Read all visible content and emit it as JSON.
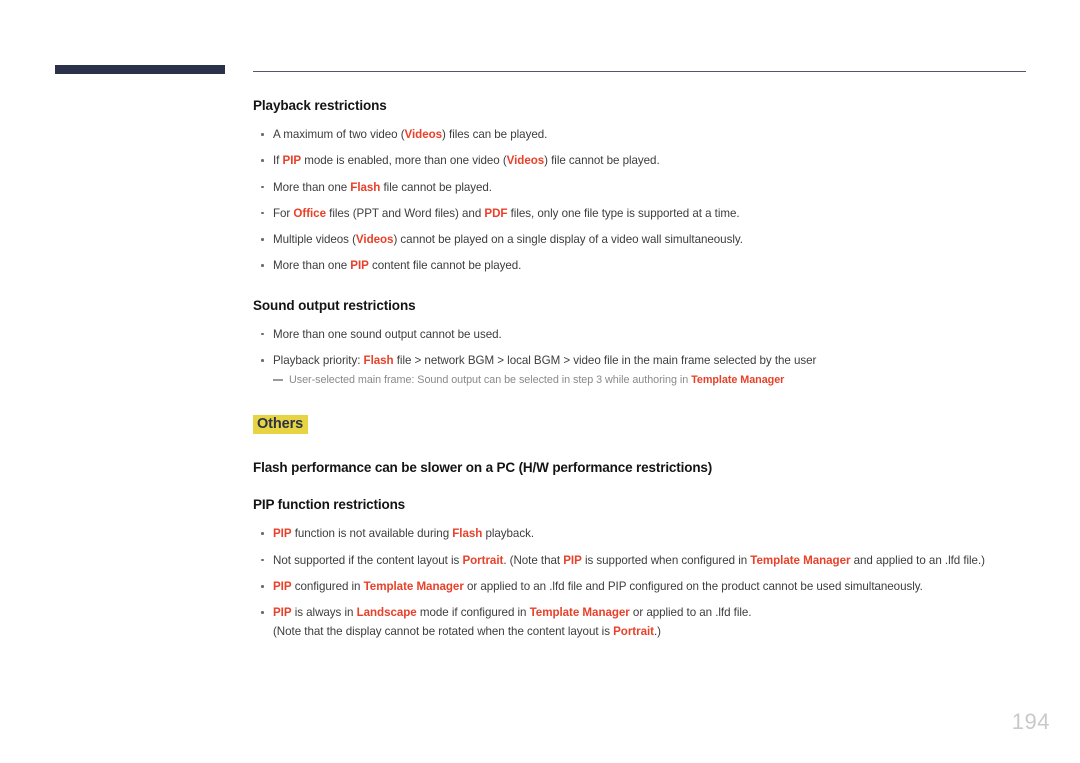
{
  "page": {
    "number": "194",
    "accent_color": "#e8412a",
    "highlight_color": "#e6d442",
    "header_bar_color": "#2b3149"
  },
  "sections": {
    "playback": {
      "heading": "Playback restrictions",
      "bullets": [
        {
          "parts": [
            {
              "t": "A maximum of two video (",
              "a": false
            },
            {
              "t": "Videos",
              "a": true
            },
            {
              "t": ") files can be played.",
              "a": false
            }
          ]
        },
        {
          "parts": [
            {
              "t": "If ",
              "a": false
            },
            {
              "t": "PIP",
              "a": true
            },
            {
              "t": " mode is enabled, more than one video (",
              "a": false
            },
            {
              "t": "Videos",
              "a": true
            },
            {
              "t": ") file cannot be played.",
              "a": false
            }
          ]
        },
        {
          "parts": [
            {
              "t": "More than one ",
              "a": false
            },
            {
              "t": "Flash",
              "a": true
            },
            {
              "t": " file cannot be played.",
              "a": false
            }
          ]
        },
        {
          "parts": [
            {
              "t": "For ",
              "a": false
            },
            {
              "t": "Office",
              "a": true
            },
            {
              "t": " files (PPT and Word files) and ",
              "a": false
            },
            {
              "t": "PDF",
              "a": true
            },
            {
              "t": " files, only one file type is supported at a time.",
              "a": false
            }
          ]
        },
        {
          "parts": [
            {
              "t": "Multiple videos (",
              "a": false
            },
            {
              "t": "Videos",
              "a": true
            },
            {
              "t": ") cannot be played on a single display of a video wall simultaneously.",
              "a": false
            }
          ]
        },
        {
          "parts": [
            {
              "t": "More than one ",
              "a": false
            },
            {
              "t": "PIP",
              "a": true
            },
            {
              "t": " content file cannot be played.",
              "a": false
            }
          ]
        }
      ]
    },
    "sound": {
      "heading": "Sound output restrictions",
      "bullets": [
        {
          "parts": [
            {
              "t": "More than one sound output cannot be used.",
              "a": false
            }
          ]
        },
        {
          "parts": [
            {
              "t": "Playback priority: ",
              "a": false
            },
            {
              "t": "Flash",
              "a": true
            },
            {
              "t": " file > network BGM > local BGM > video file in the main frame selected by the user",
              "a": false
            }
          ]
        }
      ],
      "note": {
        "parts": [
          {
            "t": "User-selected main frame: Sound output can be selected in step 3 while authoring in ",
            "a": false
          },
          {
            "t": "Template Manager",
            "a": true
          }
        ]
      }
    },
    "others": {
      "tag": "Others",
      "heading_flash": "Flash performance can be slower on a PC (H/W performance restrictions)",
      "heading_pip": "PIP function restrictions",
      "bullets": [
        {
          "parts": [
            {
              "t": "PIP",
              "a": true
            },
            {
              "t": " function is not available during ",
              "a": false
            },
            {
              "t": "Flash",
              "a": true
            },
            {
              "t": " playback.",
              "a": false
            }
          ]
        },
        {
          "parts": [
            {
              "t": "Not supported if the content layout is ",
              "a": false
            },
            {
              "t": "Portrait",
              "a": true
            },
            {
              "t": ".  (Note that ",
              "a": false
            },
            {
              "t": "PIP",
              "a": true
            },
            {
              "t": " is supported when configured in ",
              "a": false
            },
            {
              "t": "Template Manager",
              "a": true
            },
            {
              "t": " and applied to an .lfd file.)",
              "a": false
            }
          ]
        },
        {
          "parts": [
            {
              "t": "PIP",
              "a": true
            },
            {
              "t": " configured in ",
              "a": false
            },
            {
              "t": "Template Manager",
              "a": true
            },
            {
              "t": " or applied to an .lfd file and PIP configured on the product cannot be used simultaneously.",
              "a": false
            }
          ]
        },
        {
          "parts": [
            {
              "t": "PIP",
              "a": true
            },
            {
              "t": " is always in ",
              "a": false
            },
            {
              "t": "Landscape",
              "a": true
            },
            {
              "t": " mode if configured in ",
              "a": false
            },
            {
              "t": "Template Manager",
              "a": true
            },
            {
              "t": " or applied to an .lfd file.",
              "a": false
            }
          ],
          "second_line": [
            {
              "t": "(Note that the display cannot be rotated when the content layout is ",
              "a": false
            },
            {
              "t": "Portrait",
              "a": true
            },
            {
              "t": ".)",
              "a": false
            }
          ]
        }
      ]
    }
  }
}
